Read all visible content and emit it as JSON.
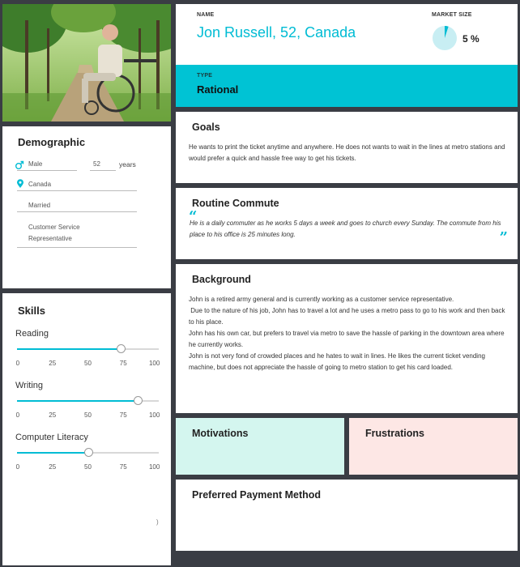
{
  "header": {
    "name_label": "NAME",
    "name_value": "Jon Russell, 52, Canada",
    "market_label": "MARKET SIZE",
    "market_value": "5 %",
    "market_fraction": 0.05
  },
  "type": {
    "label": "TYPE",
    "value": "Rational"
  },
  "demographic": {
    "title": "Demographic",
    "gender": "Male",
    "age": "52",
    "age_unit": "years",
    "location": "Canada",
    "status": "Married",
    "occupation_line1": "Customer Service",
    "occupation_line2": "Representative"
  },
  "skills": {
    "title": "Skills",
    "ticks": [
      "0",
      "25",
      "50",
      "75",
      "100"
    ],
    "items": [
      {
        "label": "Reading",
        "value": 73
      },
      {
        "label": "Writing",
        "value": 85
      },
      {
        "label": "Computer Literacy",
        "value": 50
      }
    ],
    "stray_mark": ")"
  },
  "goals": {
    "title": "Goals",
    "text": "He wants to print the ticket anytime and anywhere. He does not wants to wait in the lines at metro stations and would prefer a quick and hassle free way to get his tickets."
  },
  "commute": {
    "title": "Routine Commute",
    "text": "He is a daily commuter as he works 5 days a week and goes to church every Sunday. The commute from his place to his office is  25 minutes long."
  },
  "background": {
    "title": "Background",
    "lines": [
      "John is a retired army general and is currently working as a customer service representative.",
      " Due to the nature of his job, John has to travel a lot and he uses a metro pass to go to his work and then back to his place.",
      "John has his own car, but prefers to travel via metro to save the hassle of parking in the downtown area where he currently works.",
      "John is not very fond of crowded places and he hates to wait in lines. He likes the current ticket vending machine, but does not appreciate the hassle of going to metro station to get his card loaded."
    ]
  },
  "motivations": {
    "title": "Motivations"
  },
  "frustrations": {
    "title": "Frustrations"
  },
  "payment": {
    "title": "Preferred Payment Method"
  },
  "colors": {
    "accent": "#00bcd4",
    "background": "#3a3d44",
    "motivations_bg": "#d4f6ef",
    "frustrations_bg": "#fde7e5"
  }
}
